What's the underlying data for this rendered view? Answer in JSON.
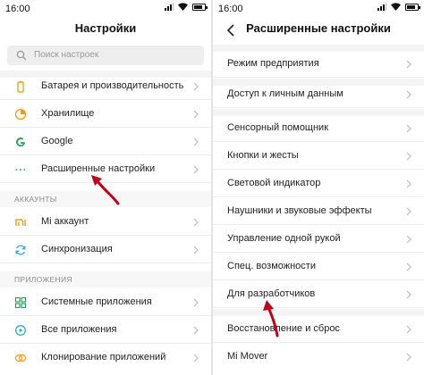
{
  "left_screen": {
    "status": {
      "time": "16:00"
    },
    "title": "Настройки",
    "search_placeholder": "Поиск настроек",
    "items_top": [
      {
        "label": "Батарея и производительность",
        "icon": "battery-icon"
      },
      {
        "label": "Хранилище",
        "icon": "storage-icon"
      },
      {
        "label": "Google",
        "icon": "google-icon"
      },
      {
        "label": "Расширенные настройки",
        "icon": "more-dots-icon"
      }
    ],
    "section_accounts": "АККАУНТЫ",
    "items_accounts": [
      {
        "label": "Mi аккаунт",
        "icon": "mi-icon"
      },
      {
        "label": "Синхронизация",
        "icon": "sync-icon"
      }
    ],
    "section_apps": "ПРИЛОЖЕНИЯ",
    "items_apps": [
      {
        "label": "Системные приложения",
        "icon": "system-apps-icon"
      },
      {
        "label": "Все приложения",
        "icon": "all-apps-icon"
      },
      {
        "label": "Клонирование приложений",
        "icon": "clone-apps-icon"
      }
    ]
  },
  "right_screen": {
    "status": {
      "time": "16:00"
    },
    "title": "Расширенные настройки",
    "items_group1": [
      {
        "label": "Режим предприятия"
      }
    ],
    "items_group2": [
      {
        "label": "Доступ к личным данным"
      }
    ],
    "items_group3": [
      {
        "label": "Сенсорный помощник"
      },
      {
        "label": "Кнопки и жесты"
      },
      {
        "label": "Световой индикатор"
      },
      {
        "label": "Наушники и звуковые эффекты"
      },
      {
        "label": "Управление одной рукой"
      },
      {
        "label": "Спец. возможности"
      },
      {
        "label": "Для разработчиков"
      }
    ],
    "items_group4": [
      {
        "label": "Восстановление и сброс"
      },
      {
        "label": "Mi Mover"
      }
    ]
  },
  "colors": {
    "accent_arrow": "#c0001a",
    "chevron": "#bdbdbd",
    "orange": "#f39c12"
  }
}
